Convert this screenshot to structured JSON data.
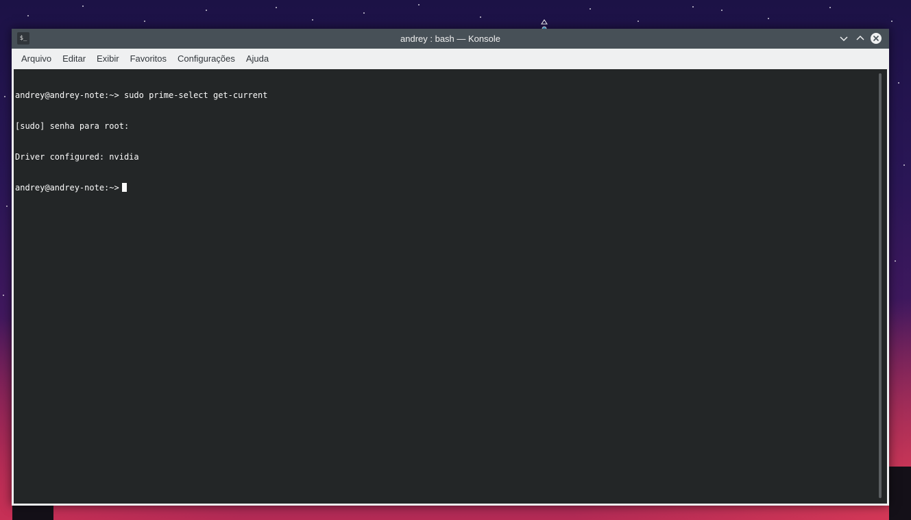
{
  "window": {
    "title": "andrey : bash — Konsole",
    "app_icon_glyph": "$_",
    "buttons": [
      "minimize-icon",
      "maximize-icon",
      "close-icon"
    ]
  },
  "menubar": {
    "items": [
      "Arquivo",
      "Editar",
      "Exibir",
      "Favoritos",
      "Configurações",
      "Ajuda"
    ]
  },
  "terminal": {
    "lines": [
      "andrey@andrey-note:~> sudo prime-select get-current",
      "[sudo] senha para root:",
      "Driver configured: nvidia",
      "andrey@andrey-note:~>"
    ],
    "cursor_line": 3
  },
  "colors": {
    "titlebar": "#475057",
    "menubar": "#eff0f1",
    "terminal_bg": "#232627",
    "terminal_fg": "#fcfcfc"
  }
}
